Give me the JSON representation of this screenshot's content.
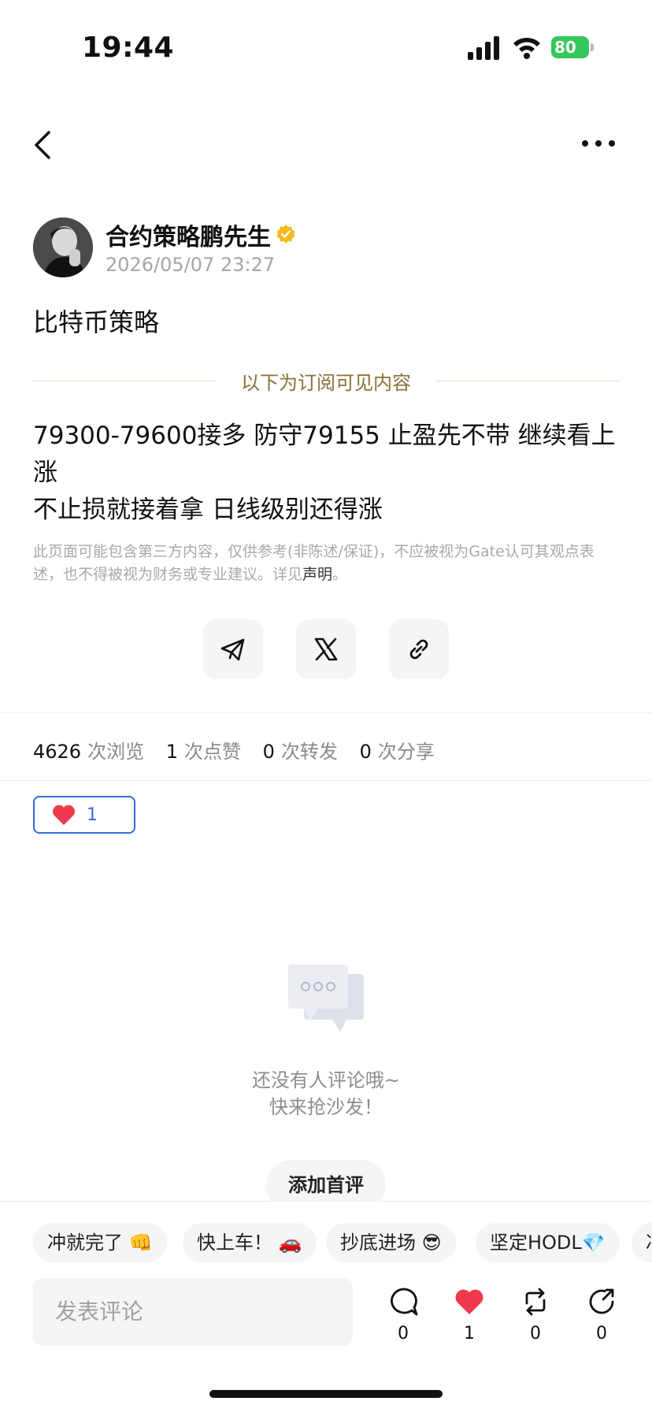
{
  "status_bar": {
    "time": "19:44",
    "battery": "80"
  },
  "post": {
    "author": "合约策略鹏先生",
    "time": "2026/05/07 23:27",
    "title": "比特币策略",
    "divider": "以下为订阅可见内容",
    "body_line1": "79300-79600接多 防守79155 止盈先不带 继续看上涨",
    "body_line2": "不止损就接着拿 日线级别还得涨",
    "disclaimer": "此页面可能包含第三方内容，仅供参考(非陈述/保证)，不应被视为Gate认可其观点表述，也不得被视为财务或专业建议。详见",
    "disclaimer_link": "声明",
    "disclaimer_end": "。"
  },
  "stats": {
    "views": "4626",
    "views_label": "次浏览",
    "likes": "1",
    "likes_label": "次点赞",
    "reposts": "0",
    "reposts_label": "次转发",
    "shares": "0",
    "shares_label": "次分享"
  },
  "reaction": {
    "count": "1"
  },
  "empty_state": {
    "line1": "还没有人评论哦~",
    "line2": "快来抢沙发！",
    "button": "添加首评"
  },
  "quick_replies": [
    "冲就完了 👊",
    "快上车！ 🚗",
    "抄底进场 😎",
    "坚定HODL💎",
    "冲"
  ],
  "comment": {
    "placeholder": "发表评论"
  },
  "actions": {
    "comments": "0",
    "likes": "1",
    "reposts": "0",
    "shares": "0"
  },
  "colors": {
    "accent": "#3a6bd6",
    "like": "#f0384f",
    "verified": "#f5b91a",
    "divider_text": "#8a6f3b"
  }
}
